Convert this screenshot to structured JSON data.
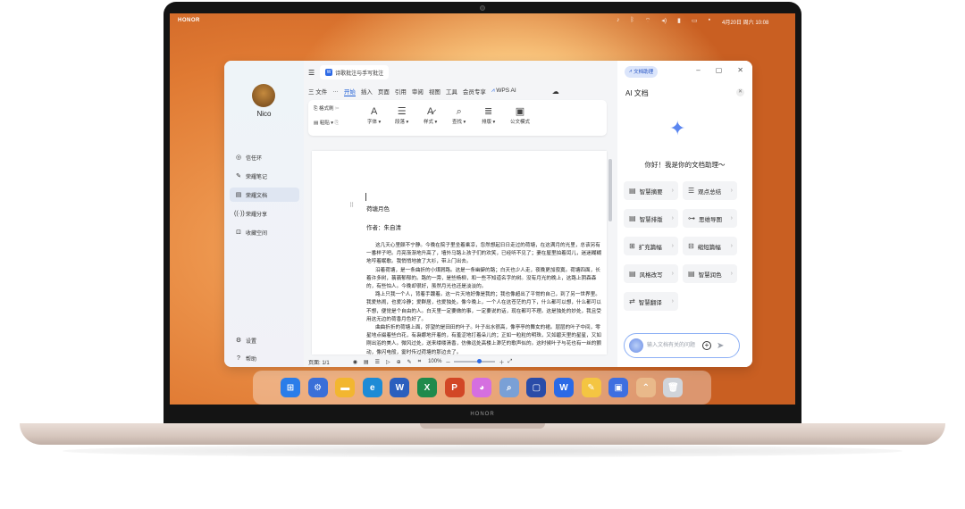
{
  "device_brand": "HONOR",
  "statusbar": {
    "brand": "HONOR",
    "icons": [
      "sound-icon",
      "bluetooth-icon",
      "wifi-icon",
      "volume-icon",
      "battery-icon",
      "tablet-icon",
      "notification-icon"
    ],
    "time": "4月20日 周六 10:08"
  },
  "sidebar": {
    "user": "Nico",
    "items": [
      {
        "label": "信任环",
        "icon": "◎"
      },
      {
        "label": "荣耀笔记",
        "icon": "✎"
      },
      {
        "label": "荣耀文档",
        "icon": "▤"
      },
      {
        "label": "荣耀分享",
        "icon": "((·))"
      },
      {
        "label": "收藏空间",
        "icon": "⊡"
      }
    ],
    "bottom": [
      {
        "label": "设置",
        "icon": "⚙"
      },
      {
        "label": "帮助",
        "icon": "?"
      }
    ]
  },
  "editor": {
    "tab_title": "诗歌批注与手写批注",
    "menu": [
      "三 文件",
      "···",
      "开始",
      "插入",
      "页面",
      "引用",
      "审阅",
      "视图",
      "工具",
      "会员专享",
      "WPS AI"
    ],
    "active_menu": "开始",
    "ribbon": [
      {
        "label": "格式刷",
        "big": ""
      },
      {
        "label": "粘贴 ▾",
        "big": ""
      },
      {
        "label": "字体 ▾",
        "big": "A"
      },
      {
        "label": "段落 ▾",
        "big": "☰"
      },
      {
        "label": "样式 ▾",
        "big": "A̷"
      },
      {
        "label": "查找 ▾",
        "big": "⌕"
      },
      {
        "label": "排版 ▾",
        "big": "≣"
      },
      {
        "label": "公文模式",
        "big": "▣"
      }
    ],
    "doc": {
      "title": "荷塘月色",
      "author": "作者：朱自清",
      "paragraphs": [
        "这几天心里颇不宁静。今晚在院子里坐着乘凉，忽然想起日日走过的荷塘，在这满月的光里，总该另有一番样子吧。月亮渐渐地升高了，墙外马路上孩子们的欢笑，已经听不见了；妻在屋里拍着闰儿，迷迷糊糊地哼着眠歌。我悄悄地披了大衫，带上门出去。",
        "沿着荷塘，是一条曲折的小煤屑路。这是一条幽僻的路；白天也少人走，夜晚更加寂寞。荷塘四面，长着许多树，蓊蓊郁郁的。路的一旁，是些杨柳，和一些不知道名字的树。没有月光的晚上，这路上阴森森的，有些怕人。今晚却很好，虽然月光也还是淡淡的。",
        "路上只我一个人，背着手踱着。这一片天地好像是我的；我也像超出了平常的自己，到了另一世界里。我爱热闹，也爱冷静；爱群居，也爱独处。像今晚上，一个人在这苍茫的月下，什么都可以想，什么都可以不想，便觉是个自由的人。白天里一定要做的事，一定要说的话，现在都可不理。这是独处的妙处，我且受用这无边的荷香月色好了。",
        "曲曲折折的荷塘上面，弥望的是田田的叶子。叶子出水很高，像亭亭的舞女的裙。层层的叶子中间，零星地点缀着些白花，有袅娜地开着的，有羞涩地打着朵儿的；正如一粒粒的明珠，又如碧天里的星星，又如刚出浴的美人。微风过处，送来缕缕清香，仿佛远处高楼上渺茫的歌声似的。这时候叶子与花也有一丝的颤动，像闪电般，霎时传过荷塘的那边去了。"
      ]
    },
    "status": {
      "page": "页面: 1/1",
      "zoom": "100%"
    }
  },
  "ai_panel": {
    "assistant_button": "文档助理",
    "title": "AI 文档",
    "greeting": "你好！我是你的文档助理～",
    "chips": [
      {
        "label": "智慧摘要",
        "icon": "▤"
      },
      {
        "label": "观点总结",
        "icon": "☰"
      },
      {
        "label": "智慧排版",
        "icon": "▤"
      },
      {
        "label": "思维导图",
        "icon": "⊶"
      },
      {
        "label": "扩充篇幅",
        "icon": "⊞"
      },
      {
        "label": "缩短篇幅",
        "icon": "⊟"
      },
      {
        "label": "风格改写",
        "icon": "▤"
      },
      {
        "label": "智慧润色",
        "icon": "▤"
      },
      {
        "label": "智慧翻译",
        "icon": "⇄"
      }
    ],
    "input_placeholder": "输入文档有关的问题"
  },
  "dock": [
    {
      "name": "windows-start",
      "color": "#2b7de9",
      "glyph": "⊞"
    },
    {
      "name": "settings",
      "color": "#3a6fd8",
      "glyph": "⚙"
    },
    {
      "name": "file-explorer",
      "color": "#f2b630",
      "glyph": "▬"
    },
    {
      "name": "edge",
      "color": "#1e8bd6",
      "glyph": "e"
    },
    {
      "name": "word",
      "color": "#2b5fbe",
      "glyph": "W"
    },
    {
      "name": "excel",
      "color": "#1f8a4c",
      "glyph": "X"
    },
    {
      "name": "powerpoint",
      "color": "#d24726",
      "glyph": "P"
    },
    {
      "name": "ai-assistant",
      "color": "#d56fe0",
      "glyph": "◕"
    },
    {
      "name": "search",
      "color": "#7aa0d6",
      "glyph": "⌕"
    },
    {
      "name": "pc-manager",
      "color": "#2a4ca8",
      "glyph": "▢"
    },
    {
      "name": "wps",
      "color": "#2b6ae6",
      "glyph": "W"
    },
    {
      "name": "notes",
      "color": "#f4c542",
      "glyph": "✎"
    },
    {
      "name": "app-market",
      "color": "#3e6fe0",
      "glyph": "▣"
    },
    {
      "name": "chevron-up",
      "color": "#e9b98a",
      "glyph": "⌃"
    },
    {
      "name": "recycle-bin",
      "color": "#d0d4da",
      "glyph": "🗑"
    }
  ]
}
